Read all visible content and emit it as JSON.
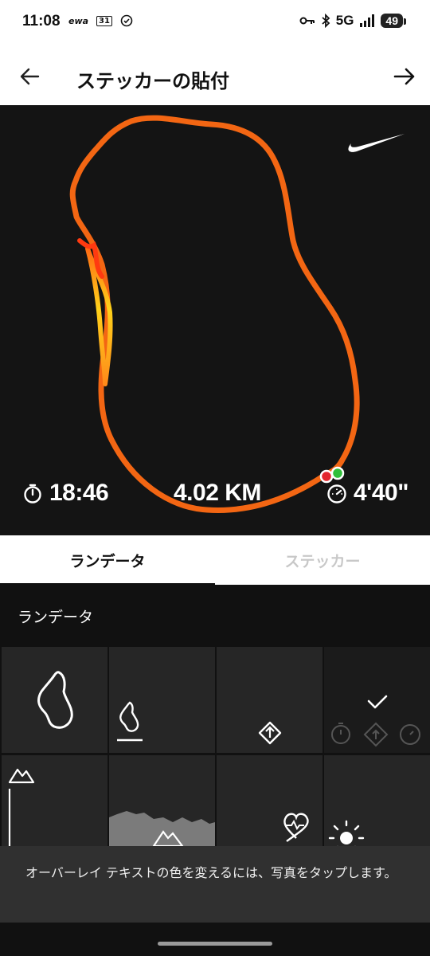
{
  "status_bar": {
    "time": "11:08",
    "notif_icons": [
      "ewa",
      "31"
    ],
    "network": "5G",
    "battery": "49"
  },
  "app_bar": {
    "title": "ステッカーの貼付",
    "back_icon": "arrow-left-icon",
    "next_icon": "arrow-right-icon"
  },
  "preview": {
    "duration": "18:46",
    "distance": "4.02 KM",
    "pace": "4'40\"",
    "route_colors": {
      "main": "#ff6a13",
      "highlight": "#ffd21a",
      "start": "#e3262d",
      "finish": "#2fbf3a"
    }
  },
  "tabs": [
    {
      "label": "ランデータ",
      "selected": true
    },
    {
      "label": "ステッカー",
      "selected": false
    }
  ],
  "panel": {
    "title": "ランデータ",
    "cells": [
      {
        "name": "route-large-sticker",
        "selected": false
      },
      {
        "name": "route-small-sticker",
        "selected": false
      },
      {
        "name": "direction-sticker",
        "selected": false
      },
      {
        "name": "stats-combo-sticker",
        "selected": true
      },
      {
        "name": "elevation-sticker",
        "selected": false
      },
      {
        "name": "elevation-chart-sticker",
        "selected": false
      },
      {
        "name": "heart-rate-sticker",
        "selected": false
      },
      {
        "name": "weather-sticker",
        "selected": false
      }
    ]
  },
  "toast": {
    "message": "オーバーレイ テキストの色を変えるには、写真をタップします。"
  }
}
